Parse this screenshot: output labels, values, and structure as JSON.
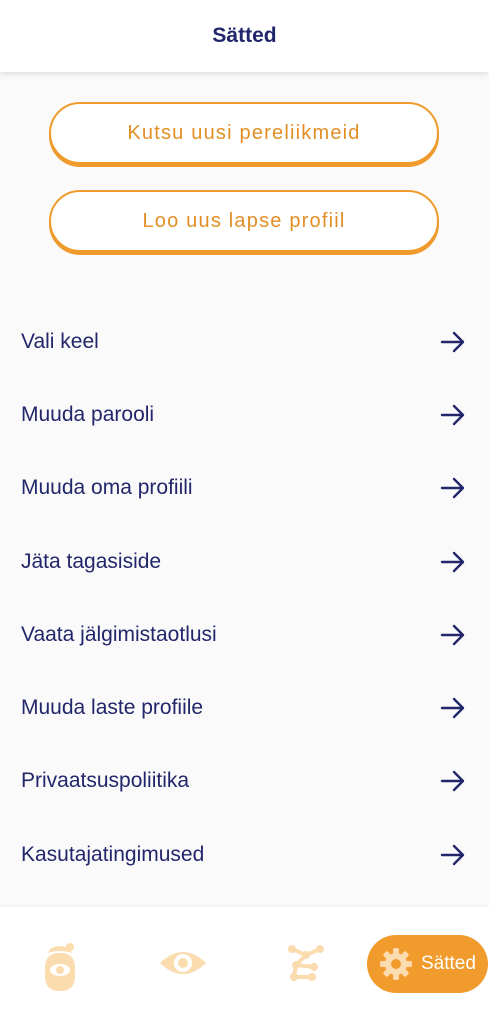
{
  "header": {
    "title": "Sätted"
  },
  "actions": {
    "invite_label": "Kutsu uusi pereliikmeid",
    "new_child_label": "Loo uus lapse profiil"
  },
  "menu": {
    "items": [
      {
        "label": "Vali keel"
      },
      {
        "label": "Muuda parooli"
      },
      {
        "label": "Muuda oma profiili"
      },
      {
        "label": "Jäta tagasiside"
      },
      {
        "label": "Vaata jälgimistaotlusi"
      },
      {
        "label": "Muuda laste profiile"
      },
      {
        "label": "Privaatsuspoliitika"
      },
      {
        "label": "Kasutajatingimused"
      }
    ],
    "arrow_icon": "arrow-right-icon"
  },
  "tabbar": {
    "tabs": [
      {
        "icon": "child-face-icon"
      },
      {
        "icon": "eye-icon"
      },
      {
        "icon": "network-icon"
      },
      {
        "icon": "gear-icon",
        "label": "Sätted",
        "active": true
      }
    ]
  },
  "colors": {
    "primary": "#22266a",
    "accent": "#f29b2d",
    "accent_inactive": "#fbdcaf",
    "background": "#fafafa"
  }
}
